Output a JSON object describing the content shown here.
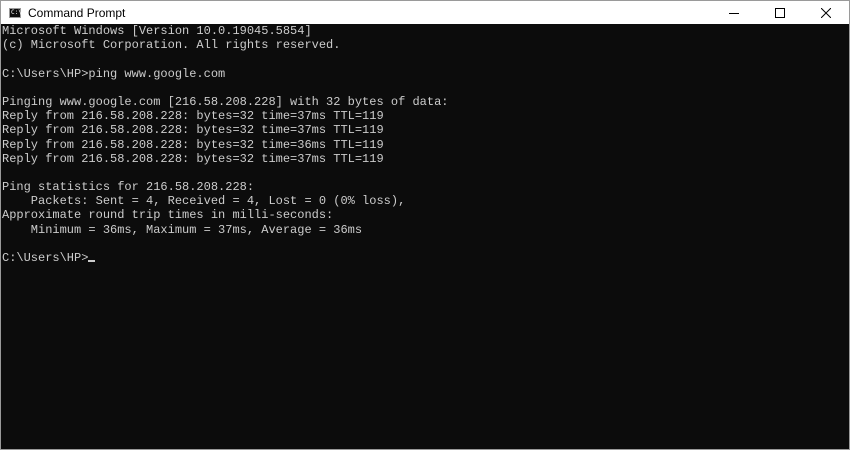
{
  "window": {
    "title": "Command Prompt",
    "icon": "command-prompt-icon",
    "icon_glyph": "C:\\",
    "controls": [
      "minimize-icon",
      "maximize-icon",
      "close-icon"
    ]
  },
  "colors": {
    "console_bg": "#0c0c0c",
    "console_text": "#cccccc",
    "titlebar_bg": "#ffffff"
  },
  "console": {
    "lines": [
      "Microsoft Windows [Version 10.0.19045.5854]",
      "(c) Microsoft Corporation. All rights reserved.",
      "",
      "C:\\Users\\HP>ping www.google.com",
      "",
      "Pinging www.google.com [216.58.208.228] with 32 bytes of data:",
      "Reply from 216.58.208.228: bytes=32 time=37ms TTL=119",
      "Reply from 216.58.208.228: bytes=32 time=37ms TTL=119",
      "Reply from 216.58.208.228: bytes=32 time=36ms TTL=119",
      "Reply from 216.58.208.228: bytes=32 time=37ms TTL=119",
      "",
      "Ping statistics for 216.58.208.228:",
      "    Packets: Sent = 4, Received = 4, Lost = 0 (0% loss),",
      "Approximate round trip times in milli-seconds:",
      "    Minimum = 36ms, Maximum = 37ms, Average = 36ms",
      ""
    ],
    "prompt": "C:\\Users\\HP>"
  }
}
